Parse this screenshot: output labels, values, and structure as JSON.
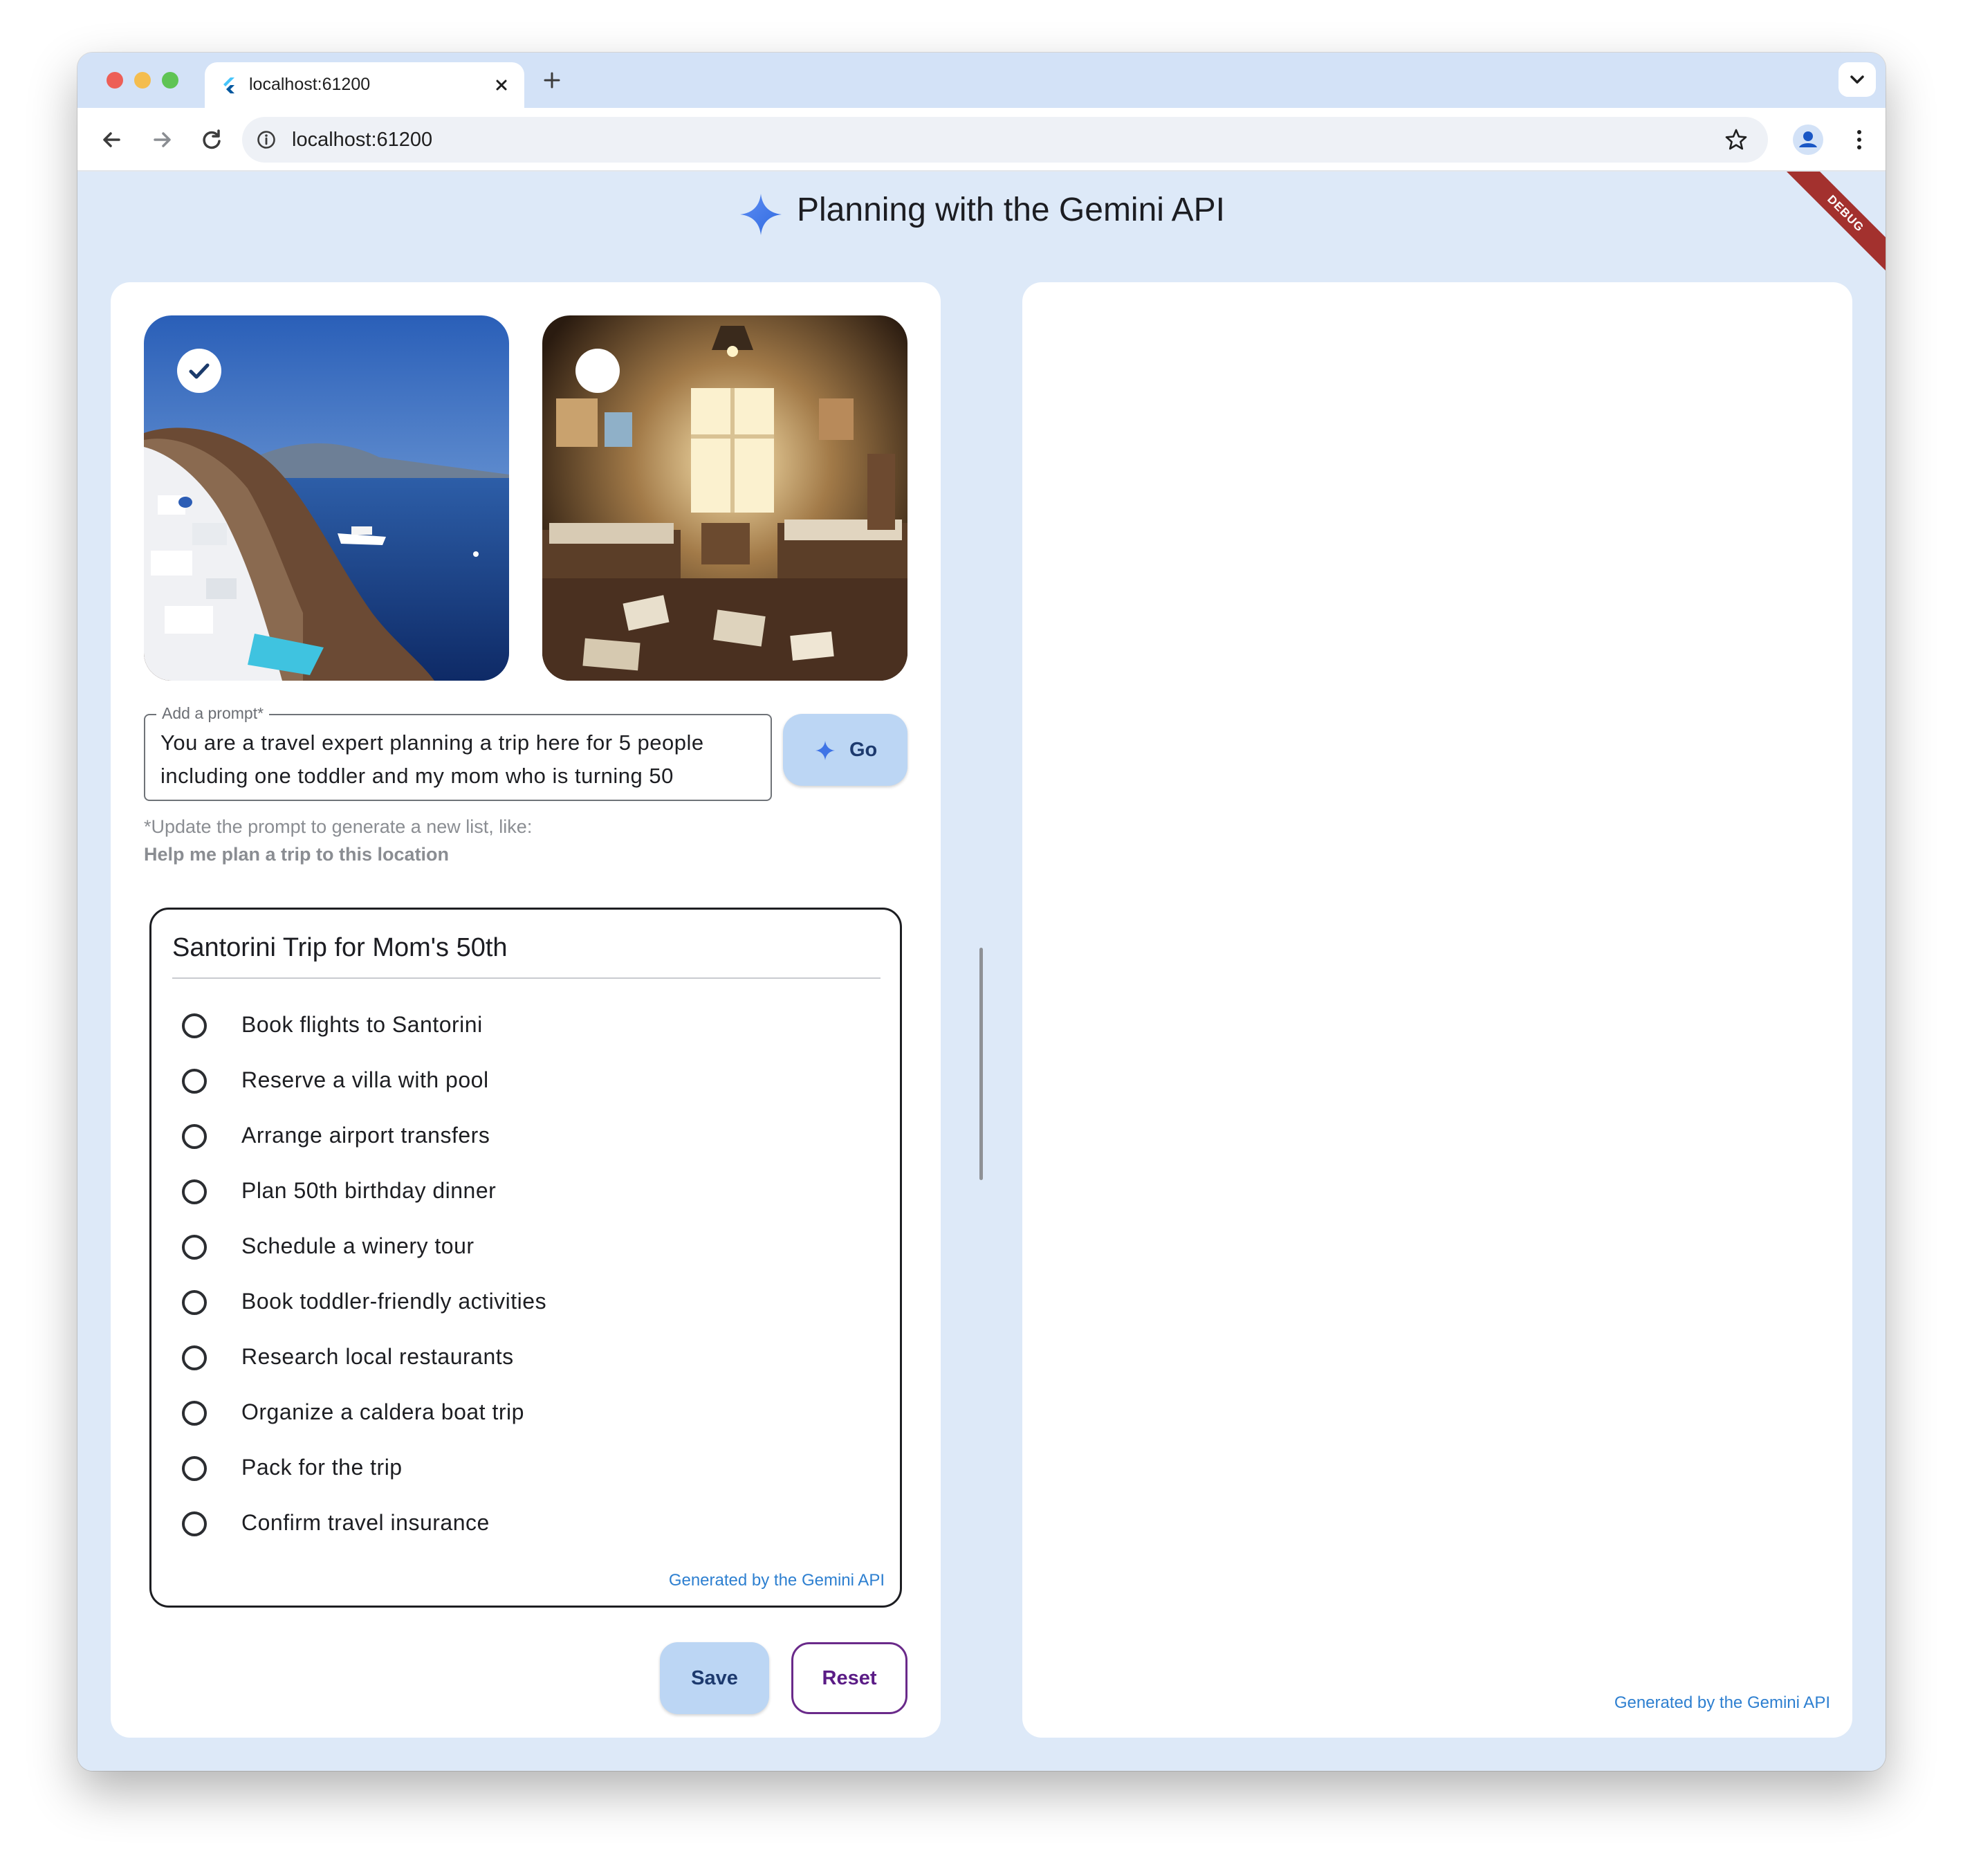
{
  "browser": {
    "tab_title": "localhost:61200",
    "url": "localhost:61200"
  },
  "debug_banner": "DEBUG",
  "app": {
    "title": "Planning with the Gemini API"
  },
  "images": [
    {
      "alt": "Santorini coastline",
      "selected": true
    },
    {
      "alt": "Cluttered room",
      "selected": false
    }
  ],
  "prompt": {
    "label": "Add a prompt*",
    "value": "You are a travel expert planning a trip here for 5 people including one toddler and my mom who is turning 50",
    "go_label": "Go",
    "hint": "*Update the prompt to generate a new list, like:",
    "hint_example": "Help me plan a trip to this location"
  },
  "checklist": {
    "title": "Santorini Trip for Mom's 50th",
    "items": [
      "Book flights to Santorini",
      "Reserve a villa with pool",
      "Arrange airport transfers",
      "Plan 50th birthday dinner",
      "Schedule a winery tour",
      "Book toddler-friendly activities",
      "Research local restaurants",
      "Organize a caldera boat trip",
      "Pack for the trip",
      "Confirm travel insurance"
    ],
    "credit": "Generated by the Gemini API"
  },
  "actions": {
    "save_label": "Save",
    "reset_label": "Reset"
  },
  "right_panel": {
    "credit": "Generated by the Gemini API"
  },
  "colors": {
    "accent": "#bcd6f4",
    "page_bg": "#dde9f8",
    "credit_link": "#2d7fd0",
    "reset_border": "#6a2a8a"
  }
}
